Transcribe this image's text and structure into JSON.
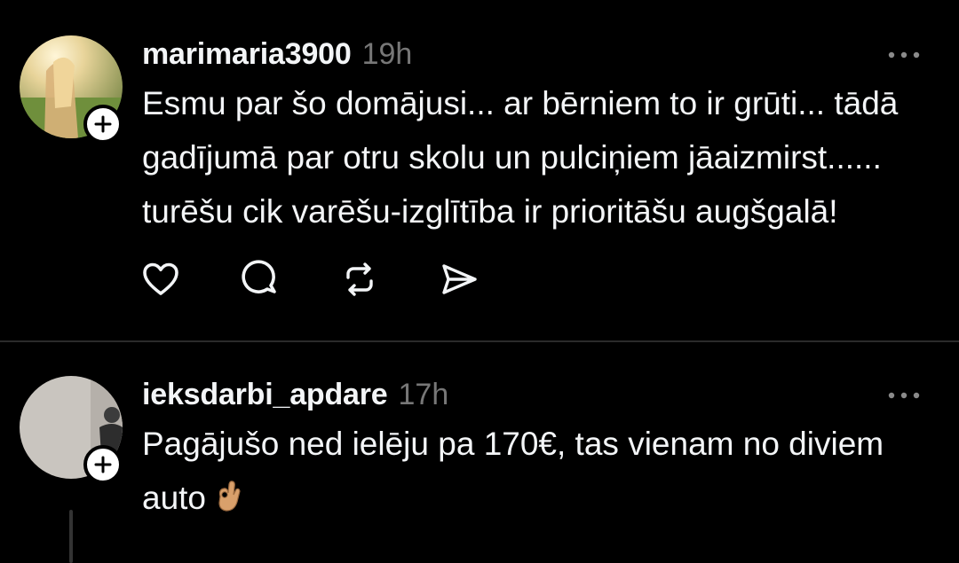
{
  "posts": [
    {
      "username": "marimaria3900",
      "time": "19h",
      "text": "Esmu par šo domājusi... ar bērniem to ir grūti... tādā gadījumā par otru skolu un pulciņiem jāaizmirst...... turēšu cik varēšu-izglītība ir prioritāšu augšgalā!"
    },
    {
      "username": "ieksdarbi_apdare",
      "time": "17h",
      "text": "Pagājušo ned ielēju pa 170€, tas vienam no diviem auto"
    }
  ],
  "icons": {
    "like": "heart-icon",
    "comment": "comment-icon",
    "repost": "repost-icon",
    "share": "share-icon",
    "more": "more-icon",
    "follow": "plus-icon",
    "emoji": "ok-hand-emoji"
  },
  "colors": {
    "background": "#000000",
    "text": "#f3f5f7",
    "muted": "#777777",
    "divider": "#2a2a2a"
  }
}
